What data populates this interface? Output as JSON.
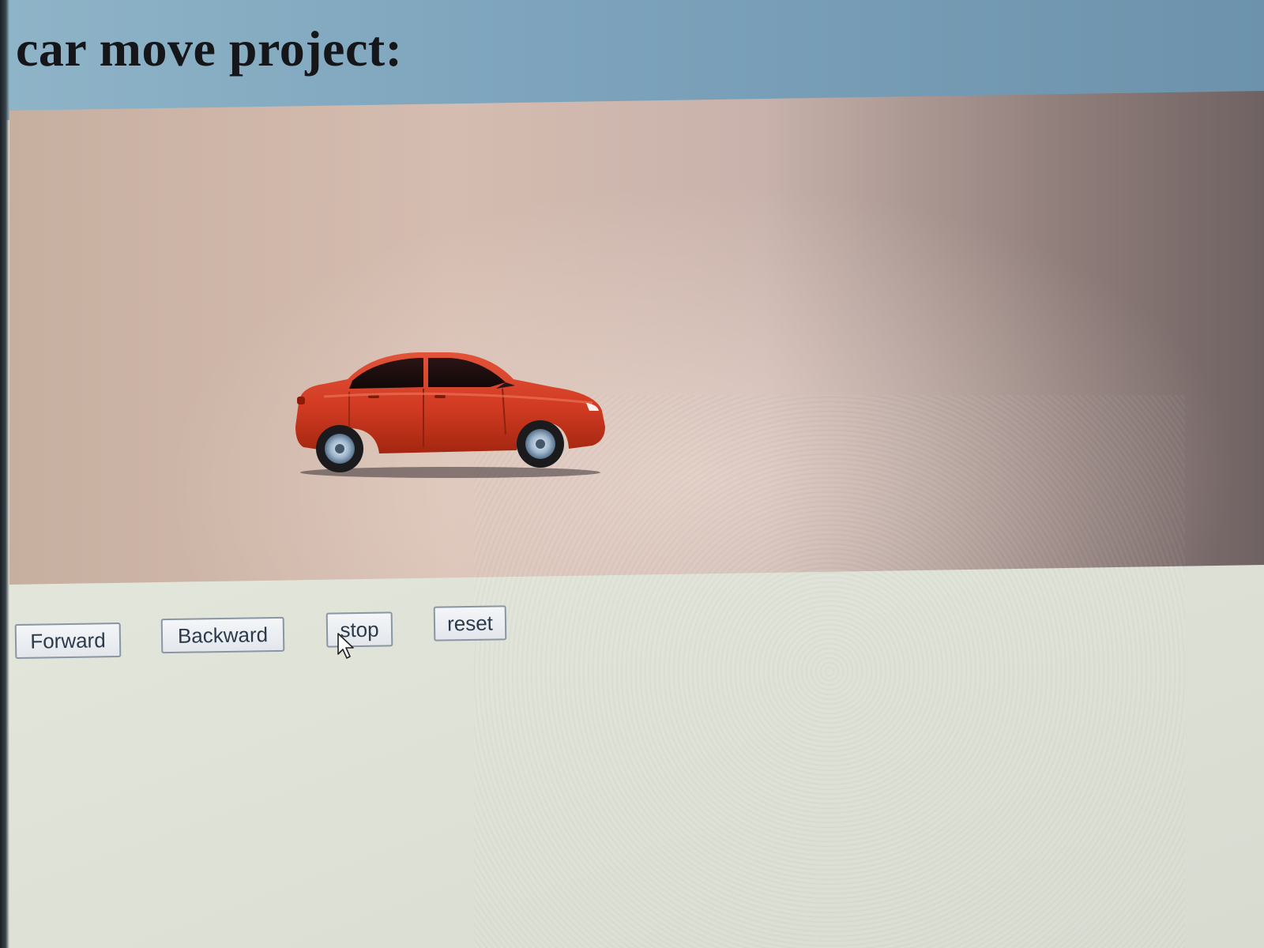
{
  "page": {
    "title": "car move project:"
  },
  "controls": {
    "forward_label": "Forward",
    "backward_label": "Backward",
    "stop_label": "stop",
    "reset_label": "reset"
  },
  "colors": {
    "car_body": "#d13a22",
    "stage_background": "#d5bcb0",
    "header_background": "#7ea5bd"
  },
  "icons": {
    "cursor": "arrow-cursor-icon",
    "car": "red-sedan-car-icon"
  }
}
